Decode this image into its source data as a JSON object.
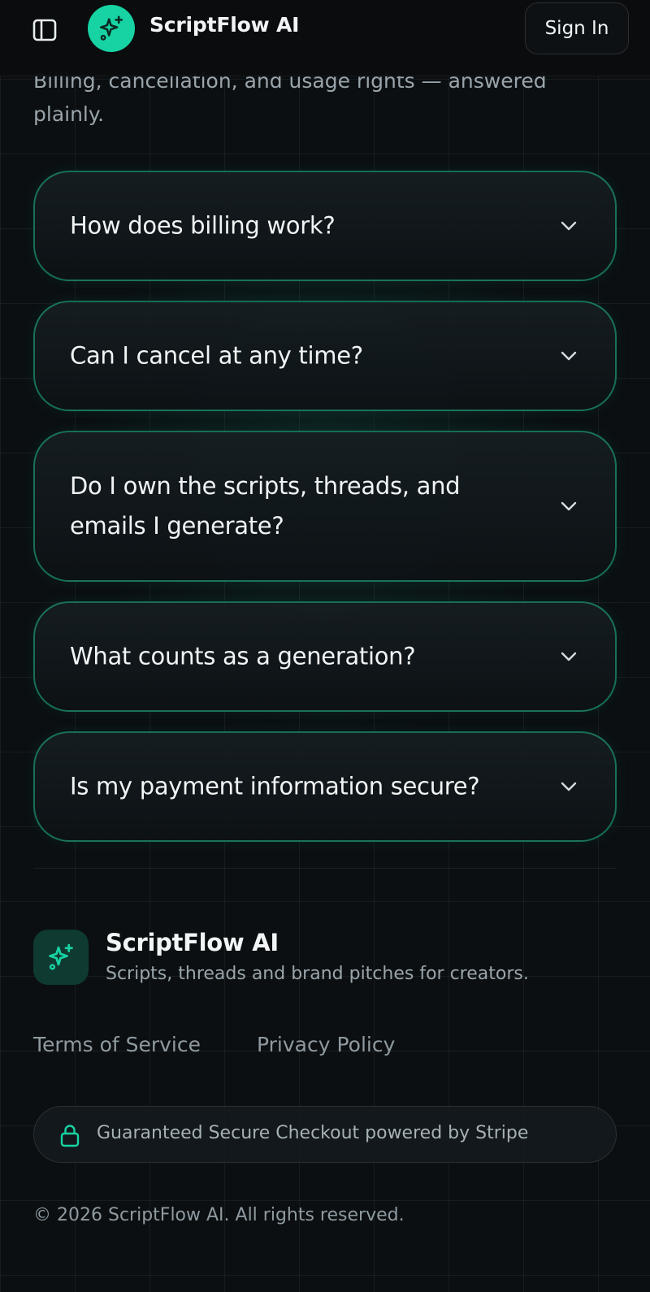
{
  "header": {
    "brand_name": "ScriptFlow AI",
    "signin_label": "Sign In"
  },
  "intro": {
    "text": "Billing, cancellation, and usage rights — answered plainly."
  },
  "faq": {
    "items": [
      {
        "question": "How does billing work?"
      },
      {
        "question": "Can I cancel at any time?"
      },
      {
        "question": "Do I own the scripts, threads, and emails I generate?"
      },
      {
        "question": "What counts as a generation?"
      },
      {
        "question": "Is my payment information secure?"
      }
    ]
  },
  "footer": {
    "brand_name": "ScriptFlow AI",
    "tagline": "Scripts, threads and brand pitches for creators.",
    "links": {
      "terms": "Terms of Service",
      "privacy": "Privacy Policy"
    },
    "secure_checkout": "Guaranteed Secure Checkout powered by Stripe",
    "copyright": "© 2026 ScriptFlow AI. All rights reserved."
  },
  "icons": {
    "sidebar_toggle": "sidebar-toggle-icon",
    "brand": "sparkles-icon",
    "faq_chevron": "chevron-down-icon",
    "secure": "lock-icon"
  },
  "colors": {
    "accent": "#17d3a3",
    "faq_border": "#1fb98e",
    "background": "#0b0f12"
  }
}
